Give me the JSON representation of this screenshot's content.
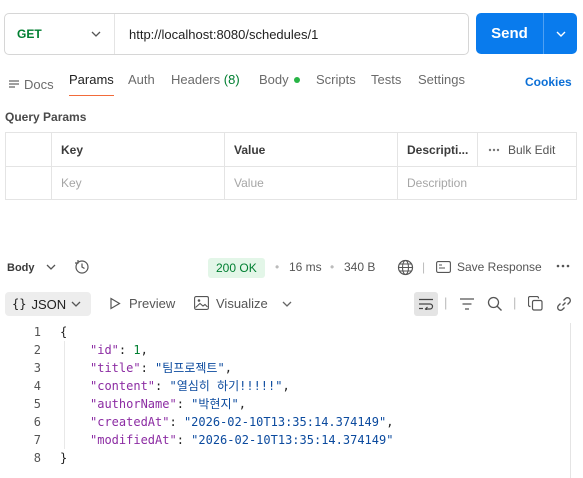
{
  "request": {
    "method": "GET",
    "url": "http://localhost:8080/schedules/1",
    "send_label": "Send"
  },
  "tabs": [
    {
      "label": "Docs"
    },
    {
      "label": "Params",
      "active": true
    },
    {
      "label": "Auth"
    },
    {
      "label": "Headers",
      "count": "(8)"
    },
    {
      "label": "Body"
    },
    {
      "label": "Scripts"
    },
    {
      "label": "Tests"
    },
    {
      "label": "Settings"
    }
  ],
  "cookies_label": "Cookies",
  "query_params": {
    "title": "Query Params",
    "headers": [
      "Key",
      "Value",
      "Descripti...",
      "Bulk Edit"
    ],
    "placeholders": [
      "Key",
      "Value",
      "Description"
    ]
  },
  "response": {
    "body_label": "Body",
    "status": "200 OK",
    "time": "16 ms",
    "size": "340 B",
    "save_label": "Save Response",
    "format": "JSON",
    "preview_label": "Preview",
    "visualize_label": "Visualize"
  },
  "code_lines": [
    {
      "n": "1",
      "text": "{"
    },
    {
      "n": "2",
      "key": "\"id\"",
      "val": "1",
      "type": "num",
      "comma": ","
    },
    {
      "n": "3",
      "key": "\"title\"",
      "val": "\"팀프로젝트\"",
      "type": "str",
      "comma": ","
    },
    {
      "n": "4",
      "key": "\"content\"",
      "val": "\"열심히 하기!!!!!\"",
      "type": "str",
      "comma": ","
    },
    {
      "n": "5",
      "key": "\"authorName\"",
      "val": "\"박현지\"",
      "type": "str",
      "comma": ","
    },
    {
      "n": "6",
      "key": "\"createdAt\"",
      "val": "\"2026-02-10T13:35:14.374149\"",
      "type": "str",
      "comma": ","
    },
    {
      "n": "7",
      "key": "\"modifiedAt\"",
      "val": "\"2026-02-10T13:35:14.374149\"",
      "type": "str",
      "comma": ""
    },
    {
      "n": "8",
      "text": "}"
    }
  ],
  "colors": {
    "accent": "#097bed",
    "method": "#007f31",
    "active_tab_underline": "#f26b3a",
    "status_bg": "#e3f6e8"
  }
}
